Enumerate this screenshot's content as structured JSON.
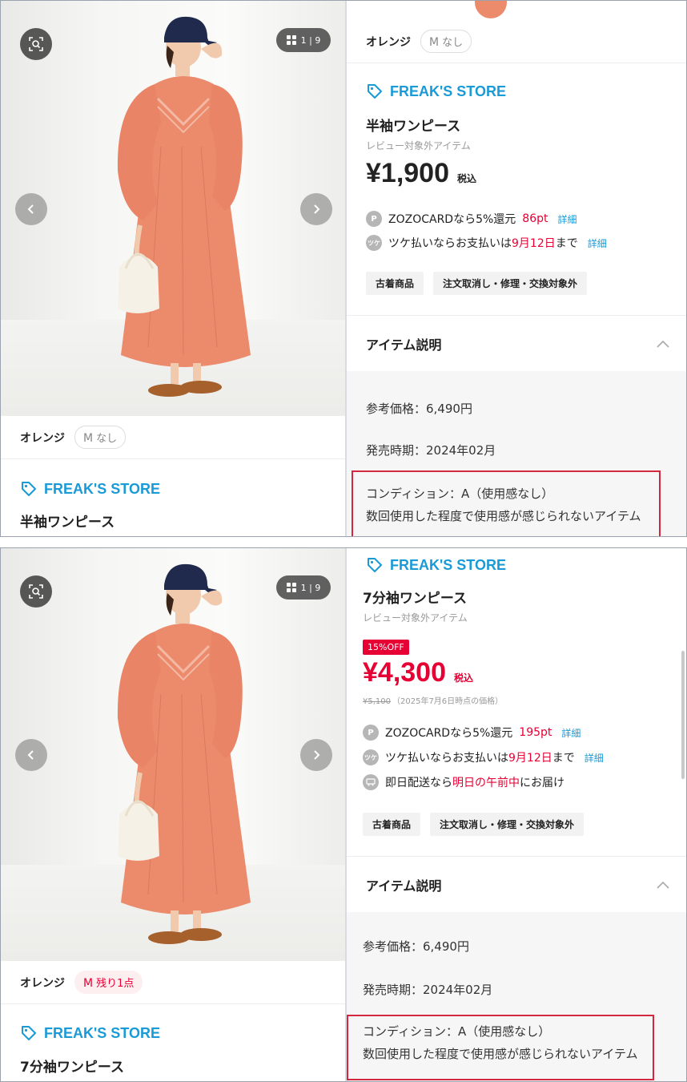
{
  "panel_a": {
    "left": {
      "counter": "1 | 9",
      "color_label": "オレンジ",
      "size_code": "M",
      "size_status": "なし",
      "store": "FREAK'S STORE",
      "item_name": "半袖ワンピース"
    },
    "right": {
      "color_label": "オレンジ",
      "size_code": "M",
      "size_status": "なし",
      "store": "FREAK'S STORE",
      "item_name": "半袖ワンピース",
      "review_note": "レビュー対象外アイテム",
      "price": "¥1,900",
      "tax": "税込",
      "zozocard_text": "ZOZOCARDなら5%還元",
      "zozocard_points": "86pt",
      "zozocard_link": "詳細",
      "tsuke_prefix": "ツケ払いならお支払いは",
      "tsuke_date": "9月12日",
      "tsuke_suffix": "まで",
      "tsuke_link": "詳細",
      "tags": [
        "古着商品",
        "注文取消し・修理・交換対象外"
      ],
      "desc_title": "アイテム説明",
      "ref_price": "参考価格：6,490円",
      "release": "発売時期：2024年02月",
      "condition": "コンディション：A（使用感なし）",
      "condition_note": "数回使用した程度で使用感が感じられないアイテム"
    }
  },
  "panel_b": {
    "left": {
      "counter": "1 | 9",
      "color_label": "オレンジ",
      "size_code": "M",
      "size_status": "残り1点",
      "store": "FREAK'S STORE",
      "item_name": "7分袖ワンピース"
    },
    "right": {
      "store": "FREAK'S STORE",
      "item_name": "7分袖ワンピース",
      "review_note": "レビュー対象外アイテム",
      "off_badge": "15%OFF",
      "price": "¥4,300",
      "tax": "税込",
      "orig_price": "¥5,100",
      "orig_note": "（2025年7月6日時点の価格）",
      "zozocard_text": "ZOZOCARDなら5%還元",
      "zozocard_points": "195pt",
      "zozocard_link": "詳細",
      "tsuke_prefix": "ツケ払いならお支払いは",
      "tsuke_date": "9月12日",
      "tsuke_suffix": "まで",
      "tsuke_link": "詳細",
      "delivery_prefix": "即日配送なら",
      "delivery_highlight": "明日の午前中",
      "delivery_suffix": "にお届け",
      "tags": [
        "古着商品",
        "注文取消し・修理・交換対象外"
      ],
      "desc_title": "アイテム説明",
      "ref_price": "参考価格：6,490円",
      "release": "発売時期：2024年02月",
      "condition": "コンディション：A（使用感なし）",
      "condition_note": "数回使用した程度で使用感が感じられないアイテム"
    }
  },
  "icons": {
    "zoom": "zoom-search-icon",
    "grid": "grid-icon",
    "prev": "chevron-left-icon",
    "next": "chevron-right-icon",
    "tag": "tag-icon",
    "points": "p-point-icon",
    "tsuke": "tsuke-icon",
    "delivery": "delivery-icon",
    "collapse": "chevron-up-icon"
  },
  "colors": {
    "accent_blue": "#1a9ad6",
    "sale_red": "#e60033",
    "highlight_border": "#d3283f",
    "dress": "#ec8a6c"
  }
}
